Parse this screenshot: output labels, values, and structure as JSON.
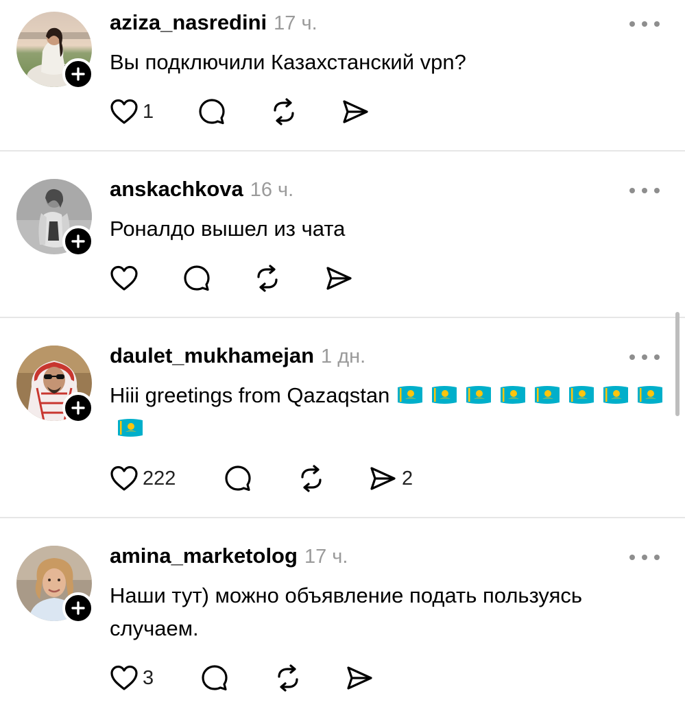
{
  "colors": {
    "text": "#000000",
    "meta": "#9a9a9a",
    "divider": "#e6e6e6",
    "badge": "#000000",
    "flag_blue": "#00afca",
    "flag_gold": "#fec50c"
  },
  "icons": {
    "like": "heart-icon",
    "reply": "speech-bubble-icon",
    "repost": "repost-arrows-icon",
    "share": "send-arrow-icon",
    "more": "ellipsis-icon",
    "follow": "plus-icon",
    "flag": "kazakhstan-flag-emoji"
  },
  "posts": [
    {
      "username": "aziza_nasredini",
      "time": "17 ч.",
      "text": "Вы подключили Казахстанский vpn?",
      "flag_count": 0,
      "likes": "1",
      "shares": ""
    },
    {
      "username": "anskachkova",
      "time": "16 ч.",
      "text": "Роналдо вышел из чата",
      "flag_count": 0,
      "likes": "",
      "shares": ""
    },
    {
      "username": "daulet_mukhamejan",
      "time": "1 дн.",
      "text": "Hiii greetings from Qazaqstan",
      "flag_count": 9,
      "likes": "222",
      "shares": "2"
    },
    {
      "username": "amina_marketolog",
      "time": "17 ч.",
      "text": "Наши тут) можно объявление подать пользуясь случаем.",
      "flag_count": 0,
      "likes": "3",
      "shares": ""
    }
  ]
}
